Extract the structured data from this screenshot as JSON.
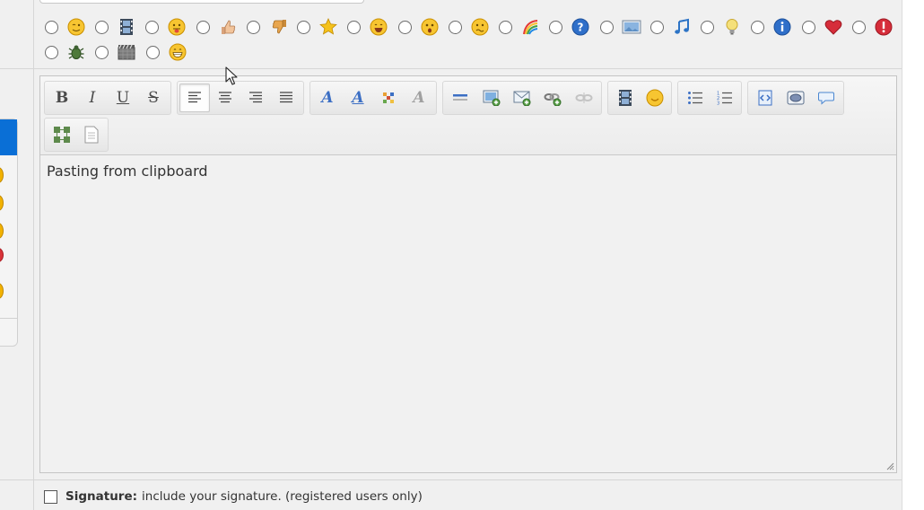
{
  "smilies": {
    "row1": [
      {
        "icon": "wink-icon"
      },
      {
        "icon": "film-icon"
      },
      {
        "icon": "tongue-icon"
      },
      {
        "icon": "thumbs-up-icon"
      },
      {
        "icon": "thumbs-down-icon"
      },
      {
        "icon": "star-icon"
      },
      {
        "icon": "laugh-icon"
      },
      {
        "icon": "shocked-icon"
      },
      {
        "icon": "confused-icon"
      },
      {
        "icon": "rainbow-icon"
      },
      {
        "icon": "question-icon"
      },
      {
        "icon": "picture-icon"
      },
      {
        "icon": "music-note-icon"
      },
      {
        "icon": "lightbulb-icon"
      },
      {
        "icon": "info-icon"
      },
      {
        "icon": "heart-icon"
      },
      {
        "icon": "exclamation-icon"
      }
    ],
    "row2": [
      {
        "icon": "bug-icon"
      },
      {
        "icon": "clapperboard-icon"
      },
      {
        "icon": "grin-icon"
      }
    ]
  },
  "toolbar": {
    "bold_label": "B",
    "italic_label": "I",
    "underline_label": "U",
    "strike_label": "S",
    "font_label": "A",
    "font_size_label": "A",
    "remove_format_label": "A"
  },
  "editor": {
    "content": "Pasting from clipboard"
  },
  "signature": {
    "label": "Signature:",
    "text": "include your signature. (registered users only)"
  },
  "colors": {
    "sidebar_tab": "#0a6fd6",
    "toolbar_icon_blue": "#3c6fc4"
  }
}
